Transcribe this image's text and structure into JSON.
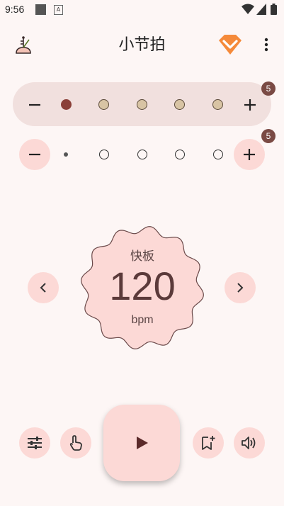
{
  "status_bar": {
    "time": "9:56",
    "notification_icon": "A"
  },
  "app_bar": {
    "title": "小节拍",
    "left_icon": "metronome-icon",
    "premium_icon": "diamond-icon",
    "menu_icon": "more-vert-icon"
  },
  "accent_row": {
    "badge": "5",
    "beats": [
      {
        "state": "filled"
      },
      {
        "state": "light"
      },
      {
        "state": "light"
      },
      {
        "state": "light"
      },
      {
        "state": "light"
      }
    ]
  },
  "subdivision_row": {
    "badge": "5",
    "beats": [
      {
        "state": "small"
      },
      {
        "state": "outline"
      },
      {
        "state": "outline"
      },
      {
        "state": "outline"
      },
      {
        "state": "outline"
      }
    ]
  },
  "tempo": {
    "name": "快板",
    "value": "120",
    "unit": "bpm"
  },
  "colors": {
    "background": "#fdf6f5",
    "accent": "#fcd9d6",
    "accent_dark": "#7a4a44",
    "beat_filled": "#8a3f38",
    "beat_light": "#d8c4a4"
  },
  "bottom_bar": {
    "icons": [
      "tune-icon",
      "tap-icon",
      "play-icon",
      "bookmark-add-icon",
      "volume-icon"
    ]
  }
}
